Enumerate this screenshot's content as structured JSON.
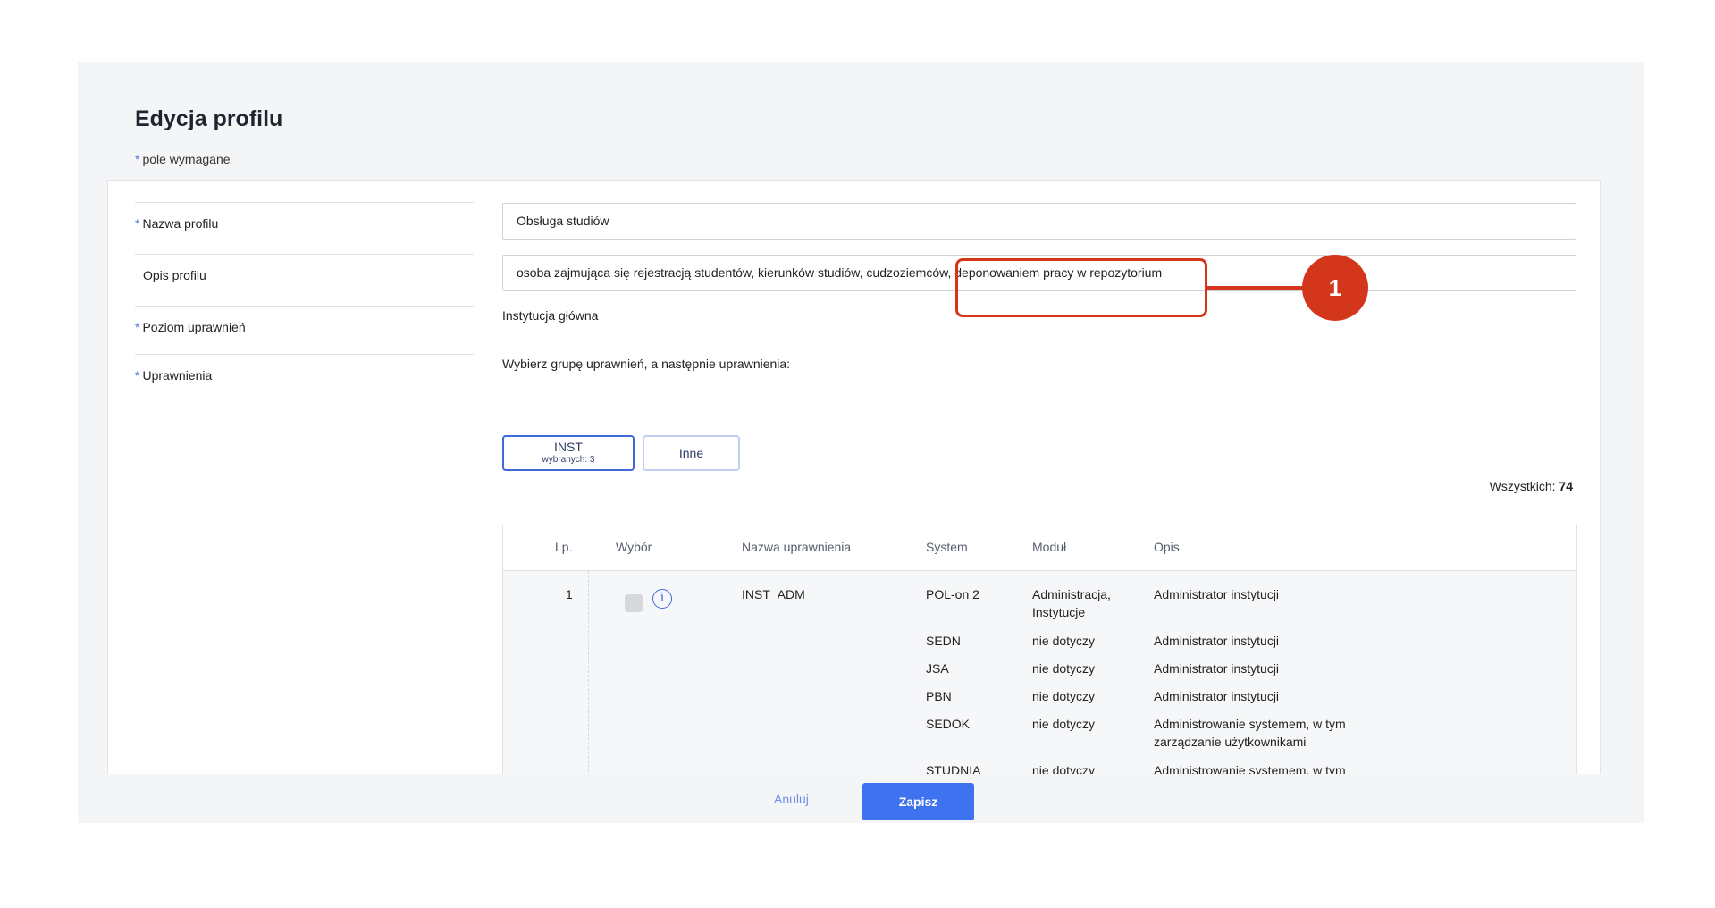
{
  "page": {
    "title": "Edycja profilu",
    "required_marker": "*",
    "required_note": "pole wymagane"
  },
  "form": {
    "name_label": "Nazwa profilu",
    "name_value": "Obsługa studiów",
    "description_label": "Opis profilu",
    "description_value": "osoba zajmująca się rejestracją studentów, kierunków studiów, cudzoziemców, deponowaniem pracy w repozytorium",
    "level_label": "Poziom uprawnień",
    "level_value": "Instytucja główna",
    "permissions_label": "Uprawnienia",
    "permissions_hint": "Wybierz grupę uprawnień, a następnie uprawnienia:"
  },
  "groups": [
    {
      "label": "INST",
      "sub": "wybranych: 3"
    },
    {
      "label": "Inne"
    }
  ],
  "total": {
    "label": "Wszystkich:",
    "value": "74"
  },
  "table": {
    "headers": [
      "Lp.",
      "Wybór",
      "Nazwa uprawnienia",
      "System",
      "Moduł",
      "Opis"
    ],
    "row": {
      "lp": "1",
      "name": "INST_ADM",
      "entries": [
        {
          "system": "POL-on 2",
          "module": "Administracja, Instytucje",
          "desc": "Administrator instytucji"
        },
        {
          "system": "SEDN",
          "module": "nie dotyczy",
          "desc": "Administrator instytucji"
        },
        {
          "system": "JSA",
          "module": "nie dotyczy",
          "desc": "Administrator instytucji"
        },
        {
          "system": "PBN",
          "module": "nie dotyczy",
          "desc": "Administrator instytucji"
        },
        {
          "system": "SEDOK",
          "module": "nie dotyczy",
          "desc": "Administrowanie systemem, w tym zarządzanie użytkownikami"
        },
        {
          "system": "STUDNIA",
          "module": "nie dotyczy",
          "desc": "Administrowanie systemem, w tym"
        }
      ]
    }
  },
  "footer": {
    "cancel": "Anuluj",
    "save": "Zapisz"
  },
  "annotation": {
    "badge": "1",
    "color": "#d4361c"
  },
  "icons": {
    "info": "info-icon"
  },
  "colors": {
    "accent": "#3f72ee",
    "annotation": "#d4361c"
  }
}
